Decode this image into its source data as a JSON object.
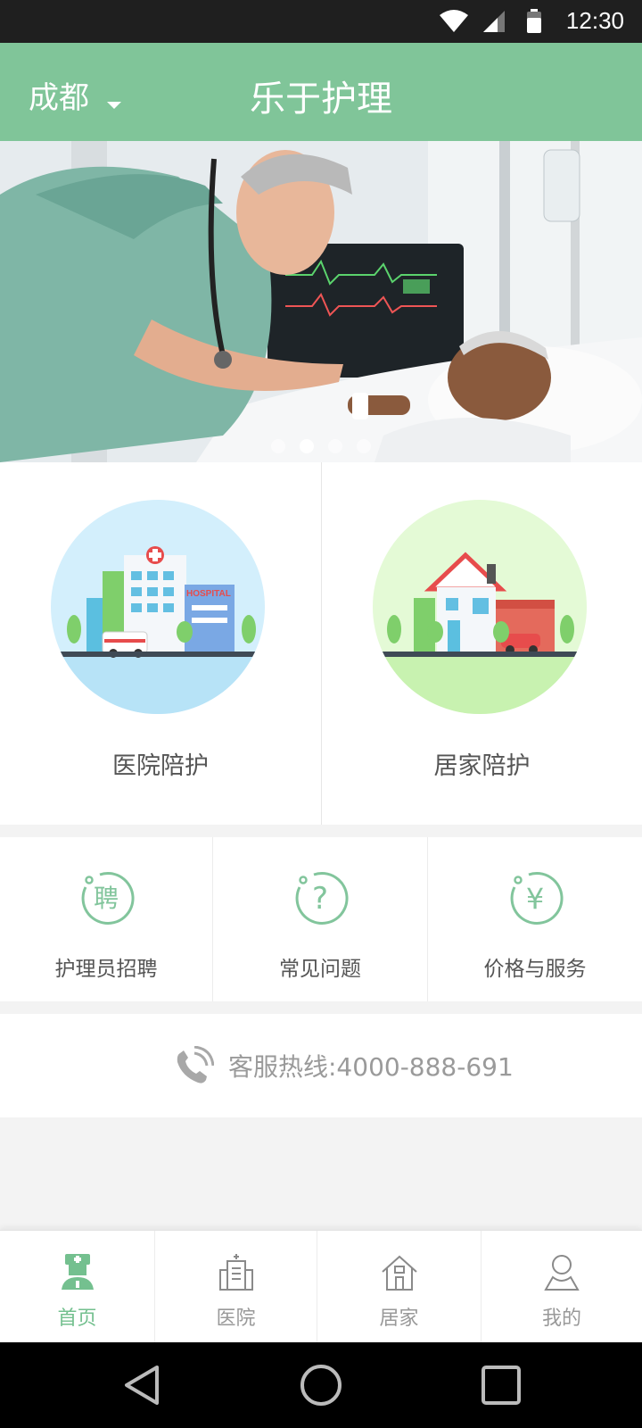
{
  "status_bar": {
    "time": "12:30"
  },
  "header": {
    "city": "成都",
    "title": "乐于护理"
  },
  "banner": {
    "dot_count": 4,
    "active_dot": 1
  },
  "services": [
    {
      "label": "医院陪护",
      "icon": "hospital-illustration",
      "hospital_sign": "HOSPITAL"
    },
    {
      "label": "居家陪护",
      "icon": "house-illustration"
    }
  ],
  "quick_links": [
    {
      "label": "护理员招聘",
      "glyph": "聘",
      "icon": "recruit-icon"
    },
    {
      "label": "常见问题",
      "glyph": "?",
      "icon": "question-icon"
    },
    {
      "label": "价格与服务",
      "glyph": "¥",
      "icon": "yen-icon"
    }
  ],
  "hotline": {
    "text": "客服热线:4000-888-691",
    "icon": "phone-icon"
  },
  "tabs": [
    {
      "label": "首页",
      "icon": "nurse-icon",
      "active": true
    },
    {
      "label": "医院",
      "icon": "hospital-icon",
      "active": false
    },
    {
      "label": "居家",
      "icon": "home-icon",
      "active": false
    },
    {
      "label": "我的",
      "icon": "user-icon",
      "active": false
    }
  ],
  "colors": {
    "brand": "#80c599",
    "active_tab": "#74c08f",
    "inactive_text": "#999999"
  }
}
